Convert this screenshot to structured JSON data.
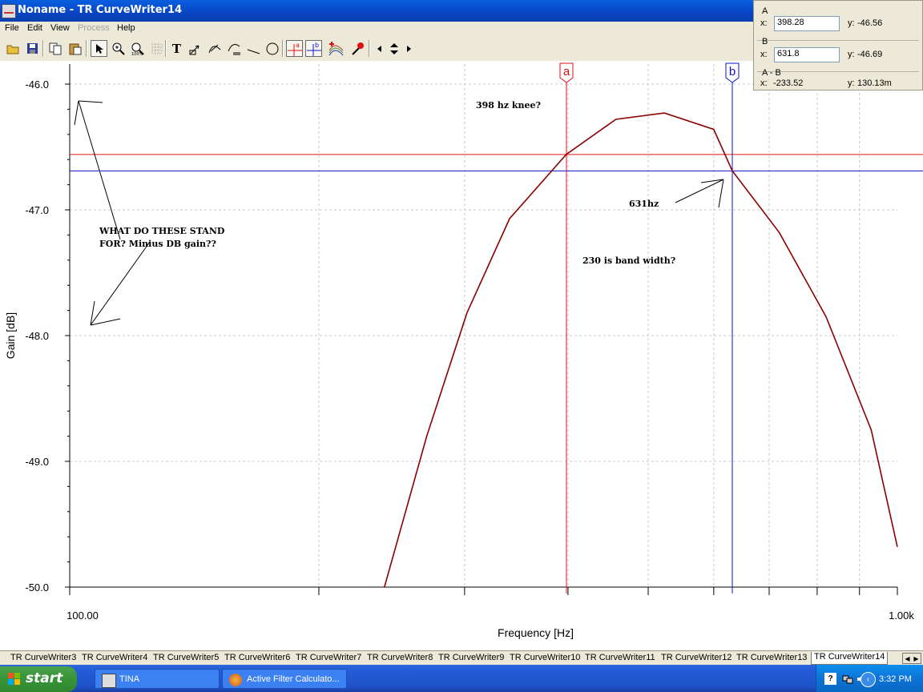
{
  "window": {
    "title": "Noname - TR CurveWriter14"
  },
  "menu": {
    "items": [
      "File",
      "Edit",
      "View",
      "Process",
      "Help"
    ],
    "disabled": [
      "Process"
    ]
  },
  "toolbar": {
    "tools": [
      "open-icon",
      "save-icon",
      "copy-icon",
      "paste-icon",
      "pointer-icon",
      "zoom-in-icon",
      "zoom-100-icon",
      "grid-icon",
      "text-icon",
      "pointer-label-icon",
      "curve-label-icon",
      "axis-label-icon",
      "line-icon",
      "circle-icon",
      "cursor-a-icon",
      "cursor-b-icon",
      "add-curve-icon",
      "marker-icon",
      "nav-left-icon",
      "nav-updown-icon",
      "nav-right-icon"
    ],
    "text_glyph": "T",
    "cursor_a_label": "a",
    "cursor_b_label": "b"
  },
  "cursor_panel": {
    "a": {
      "header": "A",
      "x_label": "x:",
      "x_value": "398.28",
      "y_label": "y:",
      "y_value": "-46.56"
    },
    "b": {
      "header": "B",
      "x_label": "x:",
      "x_value": "631.8",
      "y_label": "y:",
      "y_value": "-46.69"
    },
    "diff": {
      "header": "A - B",
      "x_label": "x:",
      "x_value": "-233.52",
      "y_label": "y:",
      "y_value": "130.13m"
    }
  },
  "chart_data": {
    "type": "line",
    "xlabel": "Frequency [Hz]",
    "ylabel": "Gain [dB]",
    "x_scale": "log",
    "xlim": [
      100,
      1000
    ],
    "ylim": [
      -50.0,
      -46.0
    ],
    "xticklabels": [
      "100.00",
      "1.00k"
    ],
    "xticks_minor": [
      200,
      300,
      400,
      500,
      600,
      700,
      800,
      900
    ],
    "yticks": [
      -46.0,
      -47.0,
      -48.0,
      -49.0,
      -50.0
    ],
    "yticklabels": [
      "-46.0",
      "-47.0",
      "-48.0",
      "-49.0",
      "-50.0"
    ],
    "grid": true,
    "series": [
      {
        "color": "#8b0000",
        "x": [
          240,
          270,
          302,
          340,
          398,
          457,
          523,
          600,
          631.8,
          720,
          820,
          930,
          1000
        ],
        "y": [
          -50.0,
          -48.8,
          -47.82,
          -47.07,
          -46.56,
          -46.28,
          -46.23,
          -46.36,
          -46.69,
          -47.18,
          -47.85,
          -48.75,
          -49.68
        ]
      }
    ],
    "cursors": [
      {
        "label": "a",
        "x": 398.28,
        "y": -46.56,
        "color": "#e01010"
      },
      {
        "label": "b",
        "x": 631.8,
        "y": -46.69,
        "color": "#1010d0"
      }
    ]
  },
  "annotations": {
    "knee": "398 hz knee?",
    "hz631": "631hz",
    "bandwidth": "230 is band width?",
    "question_line1": "WHAT DO THESE STAND",
    "question_line2": "FOR? Minius DB gain??"
  },
  "tabs": {
    "items": [
      "TR CurveWriter3",
      "TR CurveWriter4",
      "TR CurveWriter5",
      "TR CurveWriter6",
      "TR CurveWriter7",
      "TR CurveWriter8",
      "TR CurveWriter9",
      "TR CurveWriter10",
      "TR CurveWriter11",
      "TR CurveWriter12",
      "TR CurveWriter13",
      "TR CurveWriter14"
    ],
    "active": "TR CurveWriter14"
  },
  "taskbar": {
    "start_label": "start",
    "tasks": [
      {
        "label": "TINA",
        "icon": "tina-icon"
      },
      {
        "label": "Active Filter Calculato...",
        "icon": "firefox-icon"
      }
    ],
    "clock": "3:32 PM",
    "tray_icons": [
      "help-icon",
      "network-icon",
      "volume-icon",
      "collapse-tray-icon"
    ],
    "colors": {
      "start": "#3a963a",
      "taskbar": "#245edb",
      "tray": "#0c74d6"
    }
  }
}
